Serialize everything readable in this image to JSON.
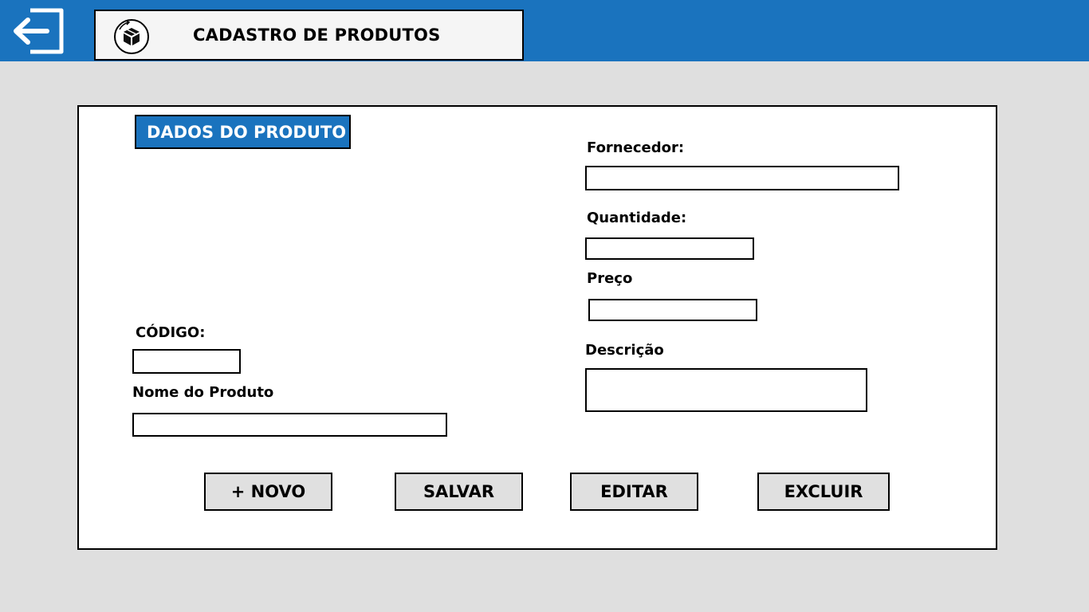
{
  "header": {
    "title": "CADASTRO DE PRODUTOS",
    "exit_icon": "exit-icon",
    "product_icon": "product-box-icon",
    "background_color": "#1a73be"
  },
  "form": {
    "section_title": "DADOS DO PRODUTO",
    "fields": {
      "codigo": {
        "label": "CÓDIGO:",
        "value": ""
      },
      "nome": {
        "label": "Nome do Produto",
        "value": ""
      },
      "fornecedor": {
        "label": "Fornecedor:",
        "value": ""
      },
      "quantidade": {
        "label": "Quantidade:",
        "value": ""
      },
      "preco": {
        "label": "Preço",
        "value": ""
      },
      "descricao": {
        "label": "Descrição",
        "value": ""
      }
    },
    "buttons": {
      "novo": "+ NOVO",
      "salvar": "SALVAR",
      "editar": "EDITAR",
      "excluir": "EXCLUIR"
    }
  },
  "colors": {
    "accent": "#1a73be",
    "background": "#dfdfdf",
    "button": "#e0e0e0"
  }
}
